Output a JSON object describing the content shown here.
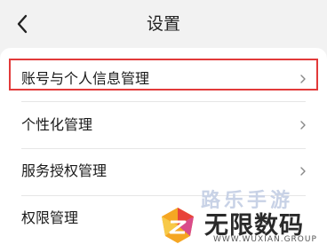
{
  "header": {
    "title": "设置",
    "back_icon": "chevron-left-icon"
  },
  "settings": {
    "items": [
      {
        "label": "账号与个人信息管理",
        "icon": "chevron-right-icon",
        "highlighted": true
      },
      {
        "label": "个性化管理",
        "icon": "chevron-right-icon"
      },
      {
        "label": "服务授权管理",
        "icon": "chevron-right-icon"
      },
      {
        "label": "权限管理",
        "icon": "chevron-right-icon"
      }
    ]
  },
  "watermark": {
    "top_text": "路乐手游",
    "main_text": "无限数码",
    "sub_text": "WWW.WUXIAN.GROUP"
  },
  "colors": {
    "highlight": "#e23a3a",
    "background": "#f2f2f2",
    "card": "#ffffff"
  }
}
